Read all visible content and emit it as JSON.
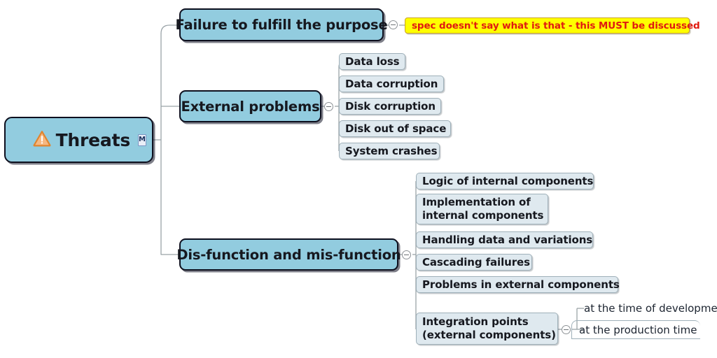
{
  "diagram": {
    "type": "mind-map",
    "background_color": "#ffffff",
    "colors": {
      "root_fill": "#92ccdf",
      "branch_fill": "#92ccdf",
      "leaf_fill": "#dfe9ef",
      "note_fill": "#feff00",
      "note_text": "#e01b10",
      "node_border": "#0d0f1e",
      "leaf_border": "#9fb0b9",
      "connector": "#9aa3a8",
      "warning_icon": "#e8903a"
    }
  },
  "root": {
    "label": "Threats",
    "icon": "warning-triangle-icon",
    "badge": "M"
  },
  "branches": [
    {
      "id": "failure",
      "label": "Failure to fulfill the purpose",
      "has_toggle": true,
      "note": {
        "text": "spec doesn't say what is that - this MUST be discussed"
      },
      "children": []
    },
    {
      "id": "external",
      "label": "External problems",
      "has_toggle": true,
      "children": [
        {
          "label": "Data loss"
        },
        {
          "label": "Data corruption"
        },
        {
          "label": "Disk corruption"
        },
        {
          "label": "Disk out of space"
        },
        {
          "label": "System crashes"
        }
      ]
    },
    {
      "id": "disfunction",
      "label": "Dis-function and mis-function",
      "has_toggle": true,
      "children": [
        {
          "label": "Logic of internal components"
        },
        {
          "label": "Implementation of\ninternal components"
        },
        {
          "label": "Handling data and variations"
        },
        {
          "label": "Cascading failures"
        },
        {
          "label": "Problems in external components"
        },
        {
          "label": "Integration points\n(external components)",
          "has_toggle": true,
          "children": [
            {
              "label": "at the time of development",
              "style": "plain"
            },
            {
              "label": "at the production time",
              "style": "underline"
            }
          ]
        }
      ]
    }
  ]
}
